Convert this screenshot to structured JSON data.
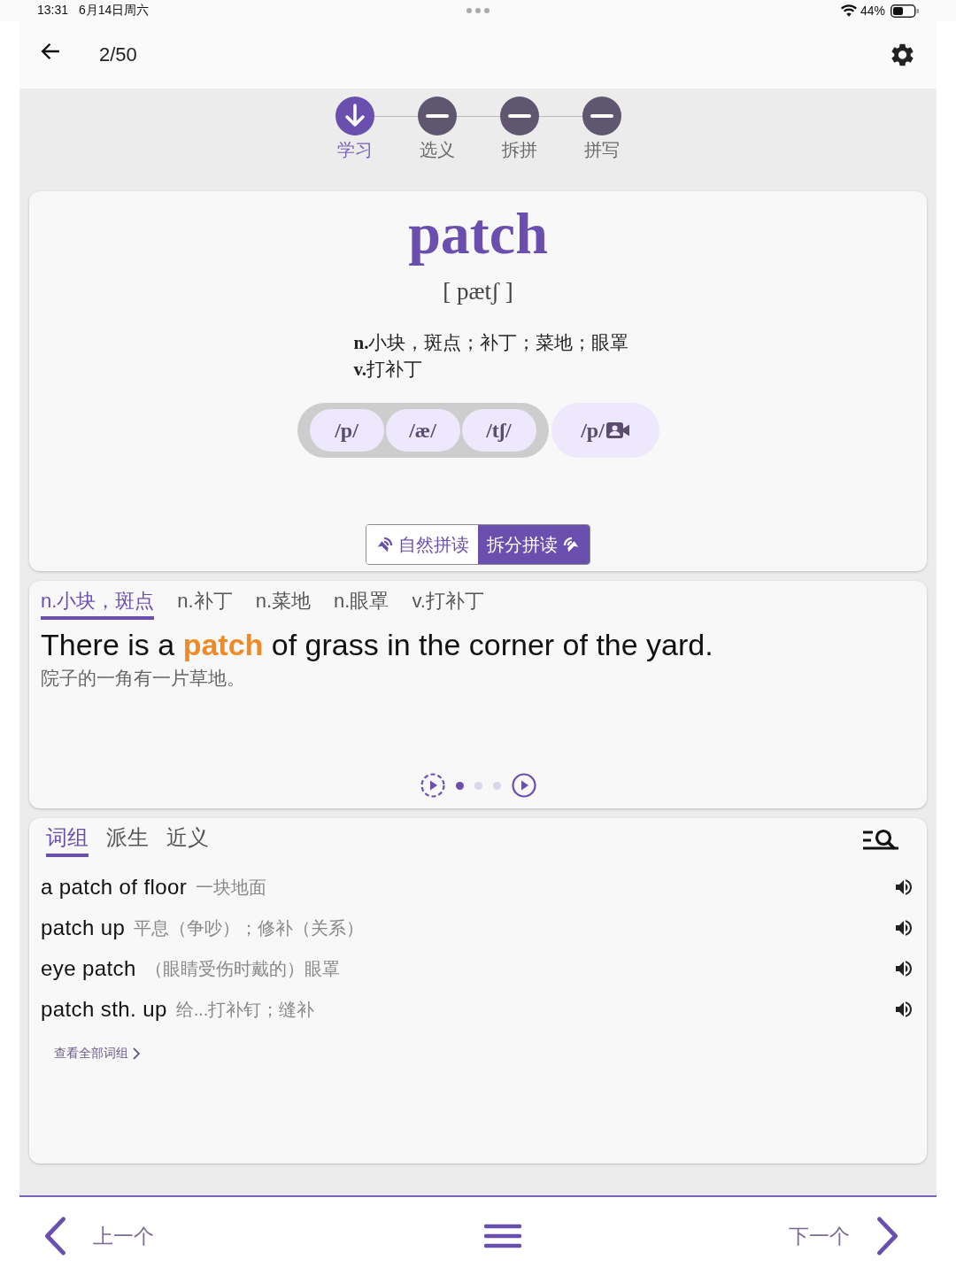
{
  "status_bar": {
    "time": "13:31",
    "date": "6月14日周六",
    "battery": "44%"
  },
  "header": {
    "counter": "2/50"
  },
  "steps": [
    {
      "label": "学习",
      "selected": true
    },
    {
      "label": "选义",
      "selected": false
    },
    {
      "label": "拆拼",
      "selected": false
    },
    {
      "label": "拼写",
      "selected": false
    }
  ],
  "word": {
    "text": "patch",
    "phonetic": "[ pætʃ ]",
    "definitions": [
      "**n.**小块，斑点；补丁；菜地；眼罩",
      "**v.**打补丁"
    ],
    "phonemes": [
      "/p/",
      "/æ/",
      "/tʃ/"
    ],
    "video_phoneme": "/p/"
  },
  "reading_modes": [
    {
      "label": "自然拼读",
      "selected": false
    },
    {
      "label": "拆分拼读",
      "selected": true
    }
  ],
  "sense_tabs": [
    {
      "label": "n.小块，斑点",
      "selected": true
    },
    {
      "label": "n.补丁",
      "selected": false
    },
    {
      "label": "n.菜地",
      "selected": false
    },
    {
      "label": "n.眼罩",
      "selected": false
    },
    {
      "label": "v.打补丁",
      "selected": false
    }
  ],
  "example": {
    "sentence": "There is a **patch** of grass in the corner of the yard.",
    "translation": "院子的一角有一片草地。",
    "pages": [
      {
        "selected": true
      },
      {
        "selected": false
      },
      {
        "selected": false
      }
    ]
  },
  "phrase_tabs": [
    {
      "label": "词组",
      "selected": true
    },
    {
      "label": "派生",
      "selected": false
    },
    {
      "label": "近义",
      "selected": false
    }
  ],
  "phrases": [
    {
      "english": "a patch of floor",
      "chinese": "一块地面"
    },
    {
      "english": "patch up",
      "chinese": "平息（争吵）；修补（关系）"
    },
    {
      "english": "eye patch",
      "chinese": "（眼睛受伤时戴的）眼罩"
    },
    {
      "english": "patch sth. up",
      "chinese": "给...打补钉；缝补"
    }
  ],
  "view_all": "查看全部词组",
  "bottom_nav": {
    "previous": "上一个",
    "next": "下一个"
  }
}
